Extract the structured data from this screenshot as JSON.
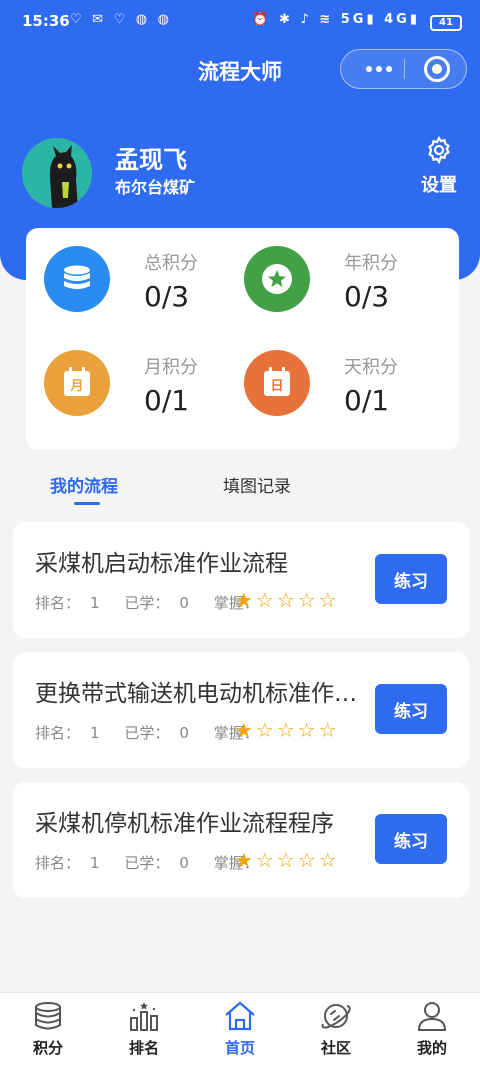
{
  "status_bar": {
    "time": "15:36",
    "battery": "41",
    "network": "4G",
    "signal": "5G"
  },
  "nav": {
    "title": "流程大师",
    "more_icon": "more-dots-icon",
    "close_icon": "target-circle-icon"
  },
  "user": {
    "name": "孟现飞",
    "org": "布尔台煤矿",
    "settings_label": "设置"
  },
  "scores": [
    {
      "label": "总积分",
      "value": "0/3",
      "color": "#2a8cf0",
      "icon": "database-icon"
    },
    {
      "label": "年积分",
      "value": "0/3",
      "color": "#43a047",
      "icon": "star-badge-icon",
      "glyph": "★"
    },
    {
      "label": "月积分",
      "value": "0/1",
      "color": "#e9a23b",
      "icon": "calendar-month-icon",
      "glyph": "月"
    },
    {
      "label": "天积分",
      "value": "0/1",
      "color": "#e8733a",
      "icon": "calendar-day-icon",
      "glyph": "日"
    }
  ],
  "tabs": [
    {
      "label": "我的流程",
      "active": true
    },
    {
      "label": "填图记录",
      "active": false
    }
  ],
  "processes": [
    {
      "title": "采煤机启动标准作业流程",
      "rank_label": "排名：",
      "rank": "1",
      "learned_label": "已学：",
      "learned": "0",
      "mastery_label": "掌握：",
      "mastery_stars": 1,
      "button": "练习"
    },
    {
      "title": "更换带式输送机电动机标准作业流程",
      "rank_label": "排名：",
      "rank": "1",
      "learned_label": "已学：",
      "learned": "0",
      "mastery_label": "掌握：",
      "mastery_stars": 1,
      "button": "练习"
    },
    {
      "title": "采煤机停机标准作业流程程序",
      "rank_label": "排名：",
      "rank": "1",
      "learned_label": "已学：",
      "learned": "0",
      "mastery_label": "掌握：",
      "mastery_stars": 1,
      "button": "练习"
    }
  ],
  "tabbar": [
    {
      "label": "积分",
      "icon": "database-icon",
      "active": false
    },
    {
      "label": "排名",
      "icon": "ranking-icon",
      "active": false
    },
    {
      "label": "首页",
      "icon": "home-icon",
      "active": true
    },
    {
      "label": "社区",
      "icon": "planet-icon",
      "active": false
    },
    {
      "label": "我的",
      "icon": "user-icon",
      "active": false
    }
  ],
  "colors": {
    "primary": "#2f6bf0",
    "star": "#f0a400"
  }
}
